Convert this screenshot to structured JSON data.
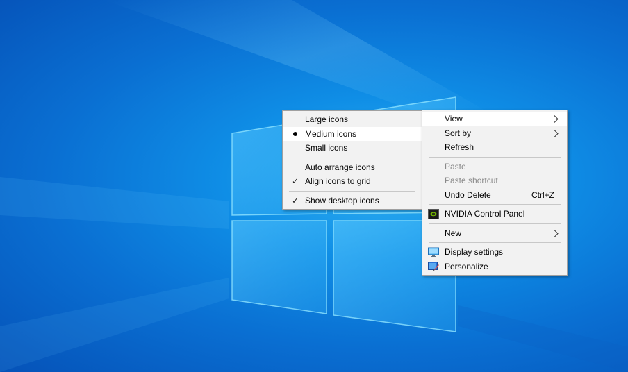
{
  "view_submenu": {
    "items": [
      {
        "label": "Large icons"
      },
      {
        "label": "Medium icons",
        "selected": true
      },
      {
        "label": "Small icons"
      },
      {
        "label": "Auto arrange icons"
      },
      {
        "label": "Align icons to grid",
        "checked": true
      },
      {
        "label": "Show desktop icons",
        "checked": true
      }
    ]
  },
  "context_menu": {
    "view": "View",
    "sort_by": "Sort by",
    "refresh": "Refresh",
    "paste": "Paste",
    "paste_shortcut": "Paste shortcut",
    "undo_delete": "Undo Delete",
    "undo_delete_shortcut": "Ctrl+Z",
    "nvidia": "NVIDIA Control Panel",
    "new": "New",
    "display_settings": "Display settings",
    "personalize": "Personalize"
  },
  "symbols": {
    "check": "✓"
  },
  "colors": {
    "menu_bg": "#f2f2f2",
    "menu_highlight": "#ffffff",
    "disabled_text": "#8a8a8a",
    "desktop_blue": "#0a6fd2"
  },
  "icons": [
    "windows-logo-wallpaper",
    "nvidia-icon",
    "display-settings-icon",
    "personalize-icon",
    "chevron-right-icon",
    "checkmark-icon",
    "radio-bullet-icon"
  ]
}
